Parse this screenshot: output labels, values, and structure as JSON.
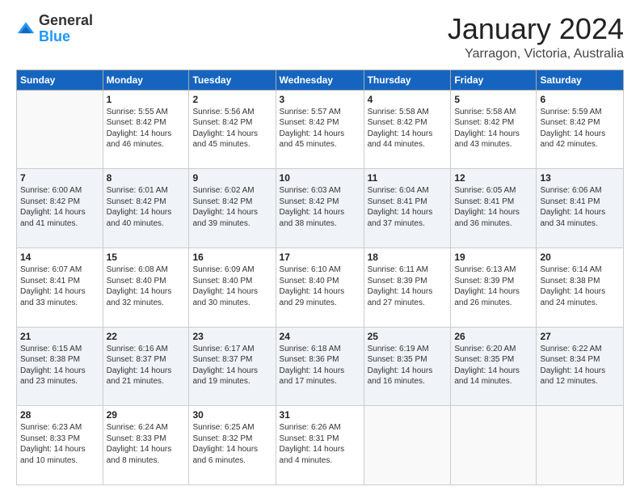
{
  "logo": {
    "general": "General",
    "blue": "Blue"
  },
  "title": "January 2024",
  "location": "Yarragon, Victoria, Australia",
  "weekdays": [
    "Sunday",
    "Monday",
    "Tuesday",
    "Wednesday",
    "Thursday",
    "Friday",
    "Saturday"
  ],
  "weeks": [
    [
      {
        "day": "",
        "empty": true
      },
      {
        "day": "1",
        "sunrise": "Sunrise: 5:55 AM",
        "sunset": "Sunset: 8:42 PM",
        "daylight": "Daylight: 14 hours and 46 minutes."
      },
      {
        "day": "2",
        "sunrise": "Sunrise: 5:56 AM",
        "sunset": "Sunset: 8:42 PM",
        "daylight": "Daylight: 14 hours and 45 minutes."
      },
      {
        "day": "3",
        "sunrise": "Sunrise: 5:57 AM",
        "sunset": "Sunset: 8:42 PM",
        "daylight": "Daylight: 14 hours and 45 minutes."
      },
      {
        "day": "4",
        "sunrise": "Sunrise: 5:58 AM",
        "sunset": "Sunset: 8:42 PM",
        "daylight": "Daylight: 14 hours and 44 minutes."
      },
      {
        "day": "5",
        "sunrise": "Sunrise: 5:58 AM",
        "sunset": "Sunset: 8:42 PM",
        "daylight": "Daylight: 14 hours and 43 minutes."
      },
      {
        "day": "6",
        "sunrise": "Sunrise: 5:59 AM",
        "sunset": "Sunset: 8:42 PM",
        "daylight": "Daylight: 14 hours and 42 minutes."
      }
    ],
    [
      {
        "day": "7",
        "sunrise": "Sunrise: 6:00 AM",
        "sunset": "Sunset: 8:42 PM",
        "daylight": "Daylight: 14 hours and 41 minutes."
      },
      {
        "day": "8",
        "sunrise": "Sunrise: 6:01 AM",
        "sunset": "Sunset: 8:42 PM",
        "daylight": "Daylight: 14 hours and 40 minutes."
      },
      {
        "day": "9",
        "sunrise": "Sunrise: 6:02 AM",
        "sunset": "Sunset: 8:42 PM",
        "daylight": "Daylight: 14 hours and 39 minutes."
      },
      {
        "day": "10",
        "sunrise": "Sunrise: 6:03 AM",
        "sunset": "Sunset: 8:42 PM",
        "daylight": "Daylight: 14 hours and 38 minutes."
      },
      {
        "day": "11",
        "sunrise": "Sunrise: 6:04 AM",
        "sunset": "Sunset: 8:41 PM",
        "daylight": "Daylight: 14 hours and 37 minutes."
      },
      {
        "day": "12",
        "sunrise": "Sunrise: 6:05 AM",
        "sunset": "Sunset: 8:41 PM",
        "daylight": "Daylight: 14 hours and 36 minutes."
      },
      {
        "day": "13",
        "sunrise": "Sunrise: 6:06 AM",
        "sunset": "Sunset: 8:41 PM",
        "daylight": "Daylight: 14 hours and 34 minutes."
      }
    ],
    [
      {
        "day": "14",
        "sunrise": "Sunrise: 6:07 AM",
        "sunset": "Sunset: 8:41 PM",
        "daylight": "Daylight: 14 hours and 33 minutes."
      },
      {
        "day": "15",
        "sunrise": "Sunrise: 6:08 AM",
        "sunset": "Sunset: 8:40 PM",
        "daylight": "Daylight: 14 hours and 32 minutes."
      },
      {
        "day": "16",
        "sunrise": "Sunrise: 6:09 AM",
        "sunset": "Sunset: 8:40 PM",
        "daylight": "Daylight: 14 hours and 30 minutes."
      },
      {
        "day": "17",
        "sunrise": "Sunrise: 6:10 AM",
        "sunset": "Sunset: 8:40 PM",
        "daylight": "Daylight: 14 hours and 29 minutes."
      },
      {
        "day": "18",
        "sunrise": "Sunrise: 6:11 AM",
        "sunset": "Sunset: 8:39 PM",
        "daylight": "Daylight: 14 hours and 27 minutes."
      },
      {
        "day": "19",
        "sunrise": "Sunrise: 6:13 AM",
        "sunset": "Sunset: 8:39 PM",
        "daylight": "Daylight: 14 hours and 26 minutes."
      },
      {
        "day": "20",
        "sunrise": "Sunrise: 6:14 AM",
        "sunset": "Sunset: 8:38 PM",
        "daylight": "Daylight: 14 hours and 24 minutes."
      }
    ],
    [
      {
        "day": "21",
        "sunrise": "Sunrise: 6:15 AM",
        "sunset": "Sunset: 8:38 PM",
        "daylight": "Daylight: 14 hours and 23 minutes."
      },
      {
        "day": "22",
        "sunrise": "Sunrise: 6:16 AM",
        "sunset": "Sunset: 8:37 PM",
        "daylight": "Daylight: 14 hours and 21 minutes."
      },
      {
        "day": "23",
        "sunrise": "Sunrise: 6:17 AM",
        "sunset": "Sunset: 8:37 PM",
        "daylight": "Daylight: 14 hours and 19 minutes."
      },
      {
        "day": "24",
        "sunrise": "Sunrise: 6:18 AM",
        "sunset": "Sunset: 8:36 PM",
        "daylight": "Daylight: 14 hours and 17 minutes."
      },
      {
        "day": "25",
        "sunrise": "Sunrise: 6:19 AM",
        "sunset": "Sunset: 8:35 PM",
        "daylight": "Daylight: 14 hours and 16 minutes."
      },
      {
        "day": "26",
        "sunrise": "Sunrise: 6:20 AM",
        "sunset": "Sunset: 8:35 PM",
        "daylight": "Daylight: 14 hours and 14 minutes."
      },
      {
        "day": "27",
        "sunrise": "Sunrise: 6:22 AM",
        "sunset": "Sunset: 8:34 PM",
        "daylight": "Daylight: 14 hours and 12 minutes."
      }
    ],
    [
      {
        "day": "28",
        "sunrise": "Sunrise: 6:23 AM",
        "sunset": "Sunset: 8:33 PM",
        "daylight": "Daylight: 14 hours and 10 minutes."
      },
      {
        "day": "29",
        "sunrise": "Sunrise: 6:24 AM",
        "sunset": "Sunset: 8:33 PM",
        "daylight": "Daylight: 14 hours and 8 minutes."
      },
      {
        "day": "30",
        "sunrise": "Sunrise: 6:25 AM",
        "sunset": "Sunset: 8:32 PM",
        "daylight": "Daylight: 14 hours and 6 minutes."
      },
      {
        "day": "31",
        "sunrise": "Sunrise: 6:26 AM",
        "sunset": "Sunset: 8:31 PM",
        "daylight": "Daylight: 14 hours and 4 minutes."
      },
      {
        "day": "",
        "empty": true
      },
      {
        "day": "",
        "empty": true
      },
      {
        "day": "",
        "empty": true
      }
    ]
  ]
}
